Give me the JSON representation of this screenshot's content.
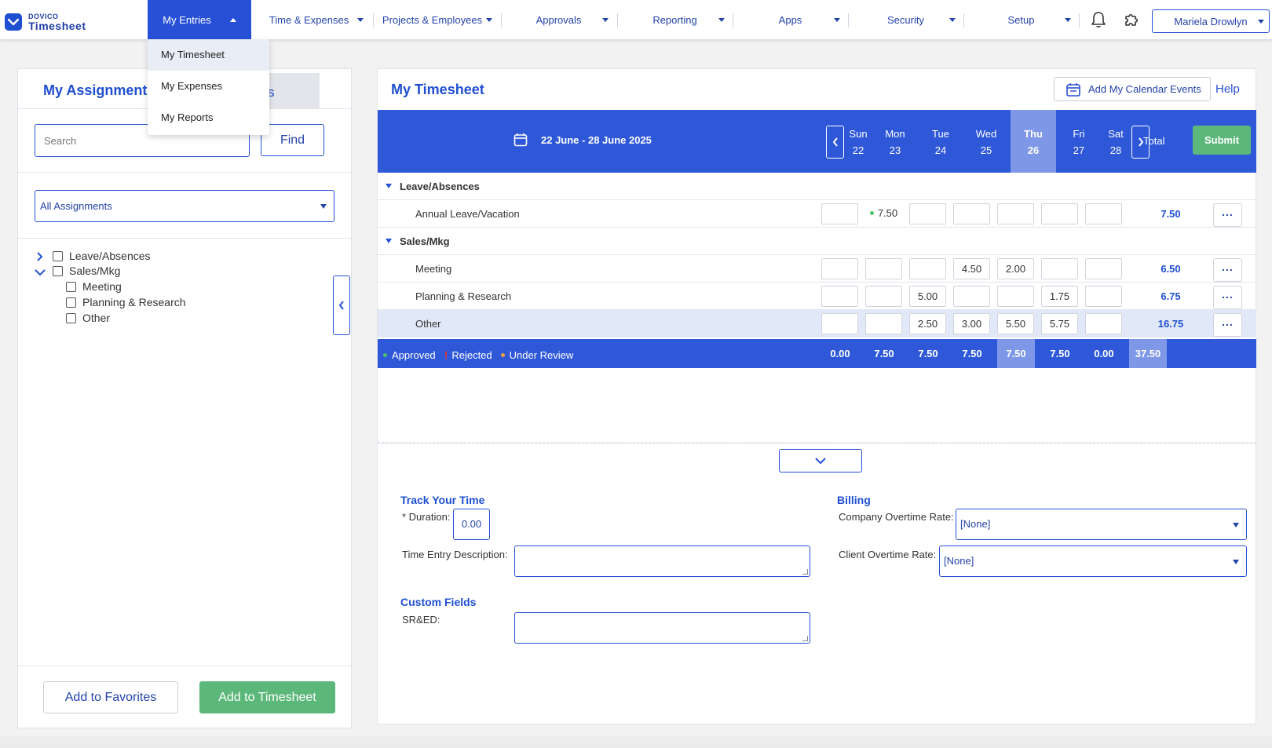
{
  "logo": {
    "top": "DOVICO",
    "bottom": "Timesheet"
  },
  "nav": {
    "my_entries": "My Entries",
    "time_expenses": "Time & Expenses",
    "projects_employees": "Projects & Employees",
    "approvals": "Approvals",
    "reporting": "Reporting",
    "apps": "Apps",
    "security": "Security",
    "setup": "Setup",
    "user": "Mariela Drowlyn"
  },
  "dropdown": {
    "items": [
      "My Timesheet",
      "My Expenses",
      "My Reports"
    ],
    "highlighted": "My Timesheet"
  },
  "left": {
    "title": "My Assignments",
    "second_tab_fragment": "s",
    "search_placeholder": "Search",
    "find_label": "Find",
    "filter_selected": "All Assignments",
    "tree": [
      {
        "label": "Leave/Absences",
        "expanded": false
      },
      {
        "label": "Sales/Mkg",
        "expanded": true,
        "children": [
          "Meeting",
          "Planning & Research",
          "Other"
        ]
      }
    ],
    "add_favorites": "Add to Favorites",
    "add_timesheet": "Add to Timesheet"
  },
  "timesheet": {
    "title": "My Timesheet",
    "calendar_button": "Add My Calendar Events",
    "help": "Help",
    "week_range": "22 June - 28 June 2025",
    "days": [
      {
        "name": "Sun",
        "date": "22"
      },
      {
        "name": "Mon",
        "date": "23"
      },
      {
        "name": "Tue",
        "date": "24"
      },
      {
        "name": "Wed",
        "date": "25"
      },
      {
        "name": "Thu",
        "date": "26"
      },
      {
        "name": "Fri",
        "date": "27"
      },
      {
        "name": "Sat",
        "date": "28"
      }
    ],
    "today_index": 4,
    "total_label": "Total",
    "submit_label": "Submit",
    "groups": [
      {
        "name": "Leave/Absences",
        "rows": [
          {
            "task": "Annual Leave/Vacation",
            "values": [
              "",
              "7.50",
              "",
              "",
              "",
              "",
              ""
            ],
            "status": [
              "",
              "approved",
              "",
              "",
              "",
              "",
              ""
            ],
            "total": "7.50"
          }
        ]
      },
      {
        "name": "Sales/Mkg",
        "rows": [
          {
            "task": "Meeting",
            "values": [
              "",
              "",
              "",
              "4.50",
              "2.00",
              "",
              ""
            ],
            "total": "6.50"
          },
          {
            "task": "Planning & Research",
            "values": [
              "",
              "",
              "5.00",
              "",
              "",
              "1.75",
              ""
            ],
            "total": "6.75"
          },
          {
            "task": "Other",
            "values": [
              "",
              "",
              "2.50",
              "3.00",
              "5.50",
              "5.75",
              ""
            ],
            "total": "16.75",
            "highlighted": true
          }
        ]
      }
    ],
    "legend": {
      "approved": "Approved",
      "rejected": "Rejected",
      "review": "Under Review"
    },
    "daily_totals": [
      "0.00",
      "7.50",
      "7.50",
      "7.50",
      "7.50",
      "7.50",
      "0.00"
    ],
    "grand_total": "37.50",
    "more_label": "..."
  },
  "details": {
    "track_title": "Track Your Time",
    "duration_label": "* Duration:",
    "duration_value": "0.00",
    "description_label": "Time Entry Description:",
    "custom_title": "Custom Fields",
    "sred_label": "SR&ED:",
    "billing_title": "Billing",
    "company_rate_label": "Company Overtime Rate:",
    "company_rate_value": "[None]",
    "client_rate_label": "Client Overtime Rate:",
    "client_rate_value": "[None]"
  },
  "colors": {
    "brand_blue": "#2750d6",
    "header_blue": "#2f58d9",
    "today_blue": "#7e97e6",
    "submit_green": "#5cb87a",
    "approved": "#4fbf6a",
    "rejected": "#e3342f",
    "review": "#f0a23a"
  }
}
